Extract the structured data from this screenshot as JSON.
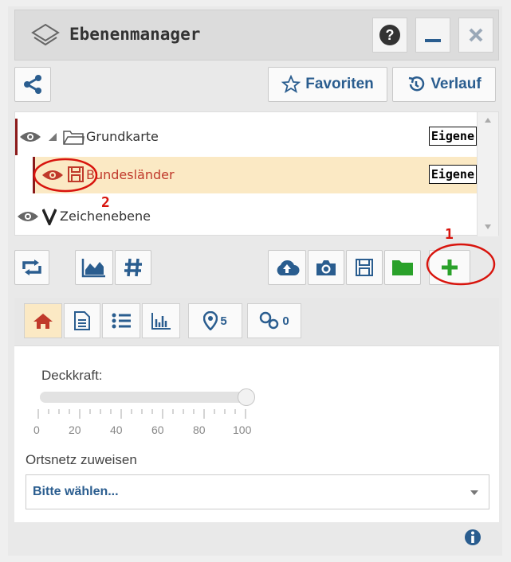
{
  "window": {
    "title": "Ebenenmanager",
    "icons": {
      "logo": "layers-icon",
      "help": "question-circle-icon",
      "minimize": "minimize-icon",
      "close": "close-icon"
    }
  },
  "toolbar": {
    "favorites_label": "Favoriten",
    "history_label": "Verlauf"
  },
  "layers": [
    {
      "label": "Grundkarte",
      "badge": "Eigene",
      "icon": "folder-icon"
    },
    {
      "label": "Bundesländer",
      "badge": "Eigene",
      "icon": "save-icon"
    },
    {
      "label": "Zeichenebene",
      "badge": "",
      "icon": "vector-icon"
    }
  ],
  "annotations": {
    "one": "1",
    "two": "2"
  },
  "tabs": {
    "markers_count": "5",
    "links_count": "0"
  },
  "opacity": {
    "label": "Deckkraft:",
    "value": 100,
    "ticks": [
      "0",
      "20",
      "40",
      "60",
      "80",
      "100"
    ]
  },
  "assign": {
    "label": "Ortsnetz zuweisen",
    "select_value": "Bitte wählen..."
  },
  "colors": {
    "accent": "#2a5d8f",
    "highlight": "#fbe9c4",
    "annotation": "#d8140d",
    "add": "#2aa12a"
  }
}
